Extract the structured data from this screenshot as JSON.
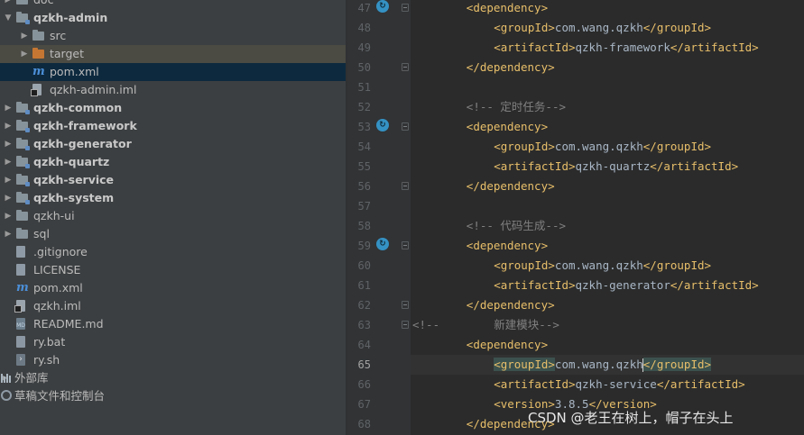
{
  "project_tree": [
    {
      "label": "doc",
      "indent": 0,
      "icon": "folder-icon",
      "arrow": "collapsed",
      "bold": false,
      "cut": true
    },
    {
      "label": "qzkh-admin",
      "indent": 0,
      "icon": "module-folder-icon",
      "arrow": "expanded",
      "bold": true
    },
    {
      "label": "src",
      "indent": 1,
      "icon": "folder-icon",
      "arrow": "collapsed",
      "bold": false
    },
    {
      "label": "target",
      "indent": 1,
      "icon": "excluded-folder-icon",
      "arrow": "collapsed",
      "bold": false,
      "state": "hover"
    },
    {
      "label": "pom.xml",
      "indent": 1,
      "icon": "maven-icon",
      "arrow": "none",
      "bold": false,
      "state": "selected"
    },
    {
      "label": "qzkh-admin.iml",
      "indent": 1,
      "icon": "iml-file-icon",
      "arrow": "none",
      "bold": false
    },
    {
      "label": "qzkh-common",
      "indent": 0,
      "icon": "module-folder-icon",
      "arrow": "collapsed",
      "bold": true
    },
    {
      "label": "qzkh-framework",
      "indent": 0,
      "icon": "module-folder-icon",
      "arrow": "collapsed",
      "bold": true
    },
    {
      "label": "qzkh-generator",
      "indent": 0,
      "icon": "module-folder-icon",
      "arrow": "collapsed",
      "bold": true
    },
    {
      "label": "qzkh-quartz",
      "indent": 0,
      "icon": "module-folder-icon",
      "arrow": "collapsed",
      "bold": true
    },
    {
      "label": "qzkh-service",
      "indent": 0,
      "icon": "module-folder-icon",
      "arrow": "collapsed",
      "bold": true
    },
    {
      "label": "qzkh-system",
      "indent": 0,
      "icon": "module-folder-icon",
      "arrow": "collapsed",
      "bold": true
    },
    {
      "label": "qzkh-ui",
      "indent": 0,
      "icon": "folder-icon",
      "arrow": "collapsed",
      "bold": false
    },
    {
      "label": "sql",
      "indent": 0,
      "icon": "folder-icon",
      "arrow": "collapsed",
      "bold": false
    },
    {
      "label": ".gitignore",
      "indent": 0,
      "icon": "gitignore-file-icon",
      "arrow": "none",
      "bold": false
    },
    {
      "label": "LICENSE",
      "indent": 0,
      "icon": "text-file-icon",
      "arrow": "none",
      "bold": false
    },
    {
      "label": "pom.xml",
      "indent": 0,
      "icon": "maven-icon",
      "arrow": "none",
      "bold": false
    },
    {
      "label": "qzkh.iml",
      "indent": 0,
      "icon": "iml-file-icon",
      "arrow": "none",
      "bold": false
    },
    {
      "label": "README.md",
      "indent": 0,
      "icon": "markdown-file-icon",
      "arrow": "none",
      "bold": false
    },
    {
      "label": "ry.bat",
      "indent": 0,
      "icon": "bat-file-icon",
      "arrow": "none",
      "bold": false
    },
    {
      "label": "ry.sh",
      "indent": 0,
      "icon": "shell-file-icon",
      "arrow": "none",
      "bold": false
    },
    {
      "label": "外部库",
      "indent": -1,
      "icon": "external-libraries-icon",
      "arrow": "collapsed",
      "bold": false
    },
    {
      "label": "草稿文件和控制台",
      "indent": -1,
      "icon": "scratches-icon",
      "arrow": "none",
      "bold": false
    }
  ],
  "editor": {
    "current_line": 65,
    "lines": [
      {
        "n": 47,
        "badge": true,
        "fold": "open",
        "parts": [
          [
            "i",
            8
          ],
          [
            "t",
            "<dependency>"
          ]
        ]
      },
      {
        "n": 48,
        "parts": [
          [
            "i",
            12
          ],
          [
            "t",
            "<groupId>"
          ],
          [
            "x",
            "com.wang.qzkh"
          ],
          [
            "t",
            "</groupId>"
          ]
        ]
      },
      {
        "n": 49,
        "parts": [
          [
            "i",
            12
          ],
          [
            "t",
            "<artifactId>"
          ],
          [
            "x",
            "qzkh-framework"
          ],
          [
            "t",
            "</artifactId>"
          ]
        ]
      },
      {
        "n": 50,
        "fold": "close",
        "parts": [
          [
            "i",
            8
          ],
          [
            "t",
            "</dependency>"
          ]
        ]
      },
      {
        "n": 51,
        "parts": []
      },
      {
        "n": 52,
        "parts": [
          [
            "i",
            8
          ],
          [
            "c",
            "<!-- 定时任务-->"
          ]
        ]
      },
      {
        "n": 53,
        "badge": true,
        "fold": "open",
        "parts": [
          [
            "i",
            8
          ],
          [
            "t",
            "<dependency>"
          ]
        ]
      },
      {
        "n": 54,
        "parts": [
          [
            "i",
            12
          ],
          [
            "t",
            "<groupId>"
          ],
          [
            "x",
            "com.wang.qzkh"
          ],
          [
            "t",
            "</groupId>"
          ]
        ]
      },
      {
        "n": 55,
        "parts": [
          [
            "i",
            12
          ],
          [
            "t",
            "<artifactId>"
          ],
          [
            "x",
            "qzkh-quartz"
          ],
          [
            "t",
            "</artifactId>"
          ]
        ]
      },
      {
        "n": 56,
        "fold": "close",
        "parts": [
          [
            "i",
            8
          ],
          [
            "t",
            "</dependency>"
          ]
        ]
      },
      {
        "n": 57,
        "parts": []
      },
      {
        "n": 58,
        "parts": [
          [
            "i",
            8
          ],
          [
            "c",
            "<!-- 代码生成-->"
          ]
        ]
      },
      {
        "n": 59,
        "badge": true,
        "fold": "open",
        "parts": [
          [
            "i",
            8
          ],
          [
            "t",
            "<dependency>"
          ]
        ]
      },
      {
        "n": 60,
        "parts": [
          [
            "i",
            12
          ],
          [
            "t",
            "<groupId>"
          ],
          [
            "x",
            "com.wang.qzkh"
          ],
          [
            "t",
            "</groupId>"
          ]
        ]
      },
      {
        "n": 61,
        "parts": [
          [
            "i",
            12
          ],
          [
            "t",
            "<artifactId>"
          ],
          [
            "x",
            "qzkh-generator"
          ],
          [
            "t",
            "</artifactId>"
          ]
        ]
      },
      {
        "n": 62,
        "fold": "close",
        "parts": [
          [
            "i",
            8
          ],
          [
            "t",
            "</dependency>"
          ]
        ]
      },
      {
        "n": 63,
        "fold": "open",
        "parts": [
          [
            "c",
            "<!--        新建模块-->"
          ]
        ]
      },
      {
        "n": 64,
        "parts": [
          [
            "i",
            8
          ],
          [
            "t",
            "<dependency>"
          ]
        ]
      },
      {
        "n": 65,
        "parts": [
          [
            "i",
            12
          ],
          [
            "th",
            "<groupId>"
          ],
          [
            "x",
            "com.wang.qzkh"
          ],
          [
            "caret",
            ""
          ],
          [
            "th",
            "</groupId>"
          ]
        ]
      },
      {
        "n": 66,
        "parts": [
          [
            "i",
            12
          ],
          [
            "t",
            "<artifactId>"
          ],
          [
            "x",
            "qzkh-service"
          ],
          [
            "t",
            "</artifactId>"
          ]
        ]
      },
      {
        "n": 67,
        "parts": [
          [
            "i",
            12
          ],
          [
            "t",
            "<version>"
          ],
          [
            "x",
            "3.8.5"
          ],
          [
            "t",
            "</version>"
          ]
        ]
      },
      {
        "n": 68,
        "parts": [
          [
            "i",
            8
          ],
          [
            "t",
            "</dependency>"
          ]
        ]
      }
    ]
  },
  "watermark": "CSDN @老王在树上，帽子在头上",
  "colors": {
    "tag": "#e8bf6a",
    "text": "#a9b7c6",
    "comment": "#808080",
    "tree_bg": "#3c3f41",
    "editor_bg": "#2b2b2b",
    "selection": "#0d293e"
  }
}
